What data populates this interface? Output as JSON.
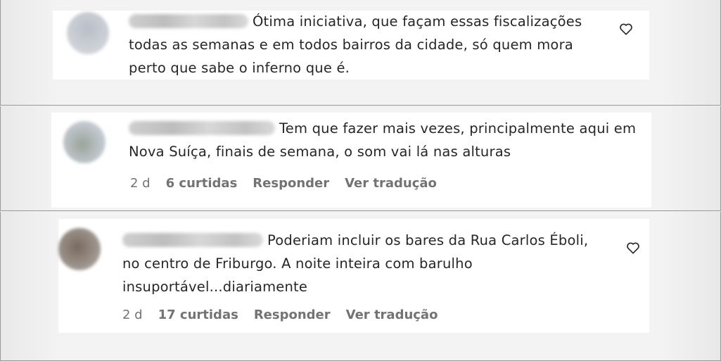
{
  "comments": [
    {
      "username": "",
      "text": "Ótima iniciativa, que façam essas fiscalizações todas as semanas e em todos bairros da cidade, só quem mora perto que sabe o inferno que é."
    },
    {
      "username": "",
      "text": "Tem que fazer mais vezes, principalmente aqui em Nova Suíça, finais de semana, o som vai lá nas alturas",
      "time": "2 d",
      "likes": "6 curtidas",
      "reply": "Responder",
      "translate": "Ver tradução"
    },
    {
      "username": "",
      "text": "Poderiam incluir os bares da Rua Carlos Éboli, no centro de Friburgo. A noite inteira com barulho insuportável...diariamente",
      "time": "2 d",
      "likes": "17 curtidas",
      "reply": "Responder",
      "translate": "Ver tradução"
    }
  ]
}
